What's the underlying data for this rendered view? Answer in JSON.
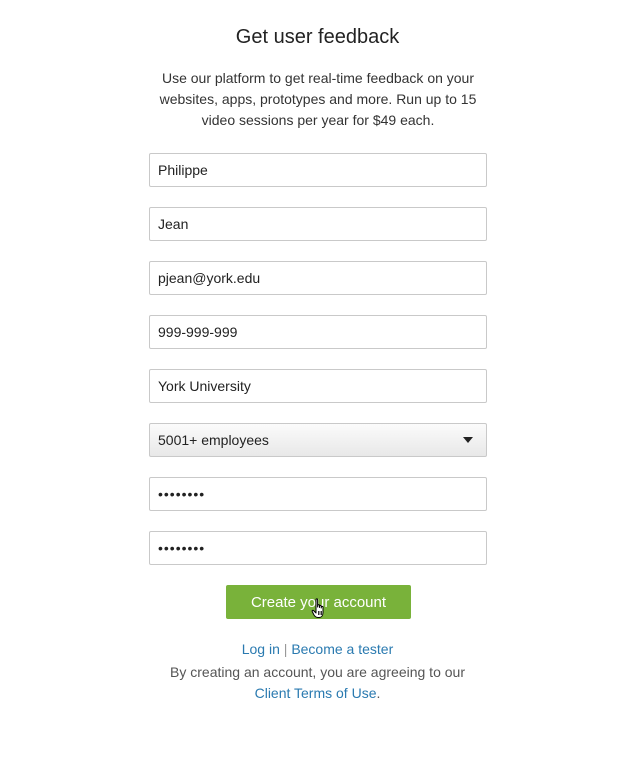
{
  "header": {
    "title": "Get user feedback",
    "intro": "Use our platform to get real-time feedback on your websites, apps, prototypes and more. Run up to 15 video sessions per year for $49 each."
  },
  "form": {
    "first_name": "Philippe",
    "last_name": "Jean",
    "email": "pjean@york.edu",
    "phone": "999-999-999",
    "company": "York University",
    "company_size": "5001+ employees",
    "password": "••••••••",
    "password_confirm": "••••••••"
  },
  "actions": {
    "create_label": "Create your account",
    "button_color": "#79b23a",
    "login_label": "Log in",
    "separator": "|",
    "tester_label": "Become a tester",
    "terms_prefix": "By creating an account, you are agreeing to our",
    "terms_link": "Client Terms of Use",
    "terms_suffix": ".",
    "link_color": "#2a7ab0"
  },
  "icons": {
    "cursor": "hand-pointer-icon"
  }
}
